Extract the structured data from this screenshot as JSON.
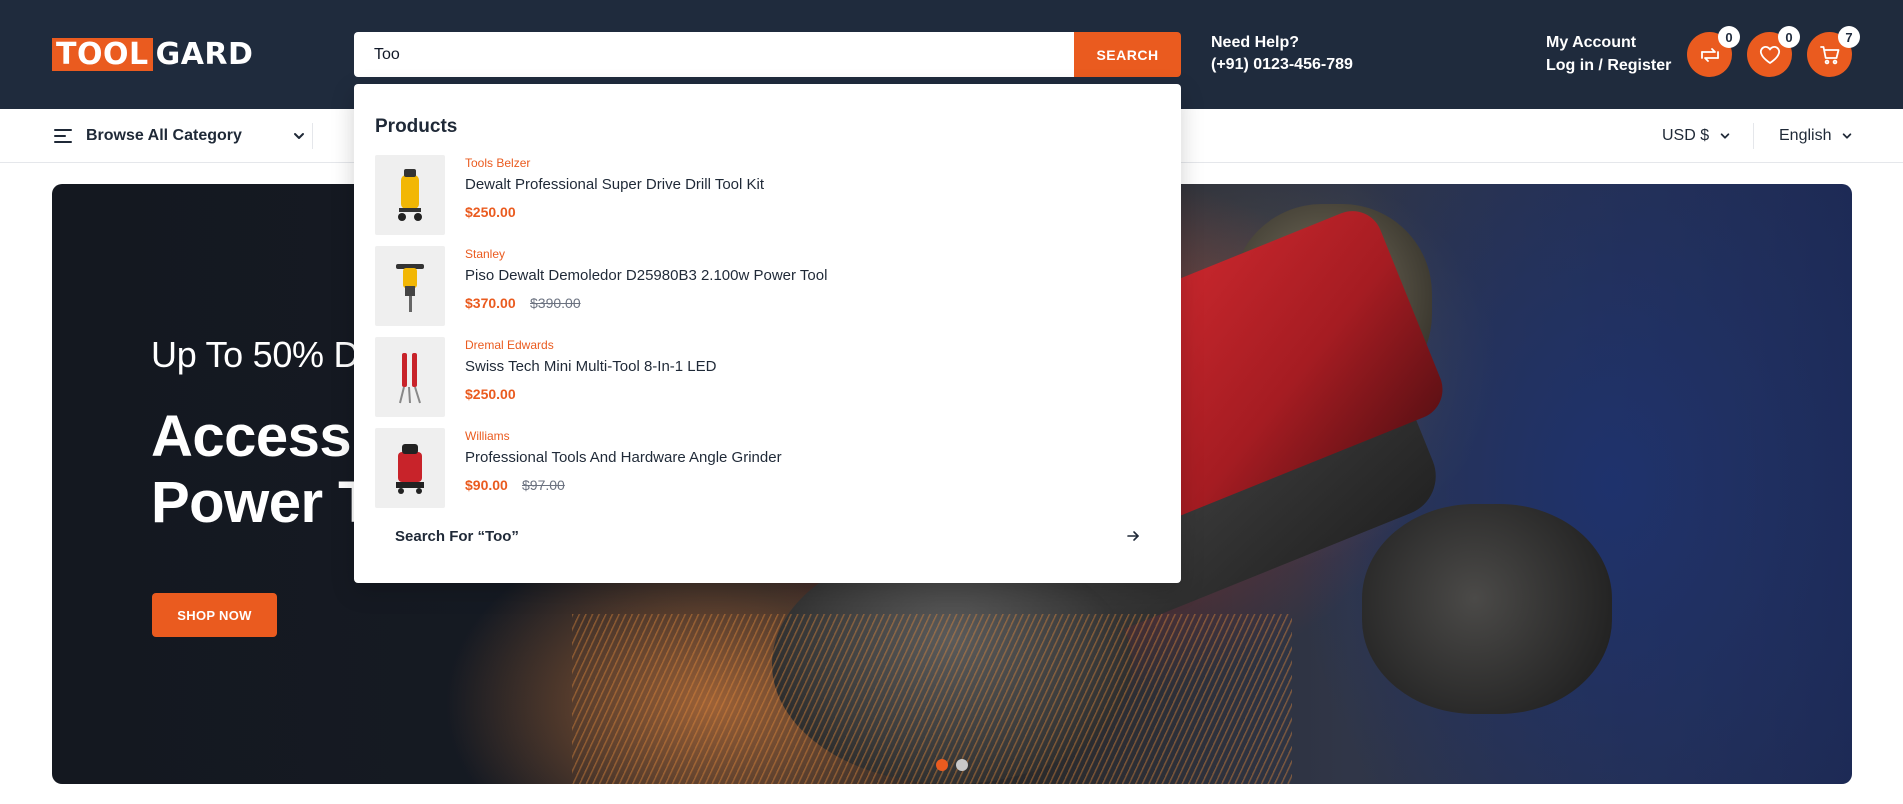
{
  "header": {
    "logo": {
      "part1": "TOOL",
      "part2": "GARD"
    },
    "search": {
      "value": "Too",
      "button_label": "SEARCH"
    },
    "help": {
      "line1": "Need Help?",
      "line2": "(+91) 0123-456-789"
    },
    "account": {
      "line1": "My Account",
      "line2": "Log in / Register"
    },
    "icons": [
      {
        "name": "compare-icon",
        "count": "0"
      },
      {
        "name": "heart-icon",
        "count": "0"
      },
      {
        "name": "cart-icon",
        "count": "7"
      }
    ],
    "accent_color": "#ea5b1f",
    "background_color": "#1f2b3d"
  },
  "nav": {
    "browse_label": "Browse All Category",
    "currency": "USD $",
    "language": "English"
  },
  "hero": {
    "subtitle": "Up To 50% D",
    "title_line1": "Access",
    "title_line2": "Power T",
    "button_label": "SHOP NOW",
    "slides": 2,
    "active_slide": 1
  },
  "dropdown": {
    "heading": "Products",
    "products": [
      {
        "brand": "Tools Belzer",
        "name": "Dewalt Professional Super Drive Drill Tool Kit",
        "price": "$250.00",
        "old_price": ""
      },
      {
        "brand": "Stanley",
        "name": "Piso Dewalt Demoledor D25980B3 2.100w Power Tool",
        "price": "$370.00",
        "old_price": "$390.00"
      },
      {
        "brand": "Dremal Edwards",
        "name": "Swiss Tech Mini Multi-Tool 8-In-1 LED",
        "price": "$250.00",
        "old_price": ""
      },
      {
        "brand": "Williams",
        "name": "Professional Tools And Hardware Angle Grinder",
        "price": "$90.00",
        "old_price": "$97.00"
      }
    ],
    "search_for": "Search For “Too”"
  }
}
